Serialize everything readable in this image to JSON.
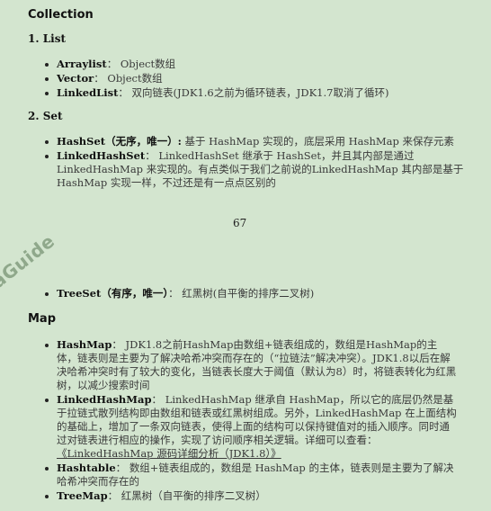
{
  "collection": {
    "title": "Collection",
    "list": {
      "heading": "1. List",
      "items": [
        {
          "term": "Arraylist",
          "sep": "： ",
          "desc": "Object数组"
        },
        {
          "term": "Vector",
          "sep": "： ",
          "desc": "Object数组"
        },
        {
          "term": "LinkedList",
          "sep": "： ",
          "desc": "双向链表(JDK1.6之前为循环链表，JDK1.7取消了循环)"
        }
      ]
    },
    "set": {
      "heading": "2. Set",
      "items": [
        {
          "term": "HashSet（无序，唯一）:",
          "sep": " ",
          "desc": "基于 HashMap 实现的，底层采用 HashMap 来保存元素"
        },
        {
          "term": "LinkedHashSet",
          "sep": "： ",
          "desc": "LinkedHashSet 继承于 HashSet，并且其内部是通过 LinkedHashMap 来实现的。有点类似于我们之前说的LinkedHashMap 其内部是基于 HashMap 实现一样，不过还是有一点点区别的"
        },
        {
          "term": "TreeSet（有序，唯一）",
          "sep": "： ",
          "desc": "红黑树(自平衡的排序二叉树)"
        }
      ]
    }
  },
  "page_number": "67",
  "watermark": "aGuide",
  "map": {
    "title": "Map",
    "items": [
      {
        "term": "HashMap",
        "sep": "： ",
        "desc": "JDK1.8之前HashMap由数组+链表组成的，数组是HashMap的主体，链表则是主要为了解决哈希冲突而存在的（“拉链法”解决冲突）。JDK1.8以后在解决哈希冲突时有了较大的变化，当链表长度大于阈值（默认为8）时，将链表转化为红黑树，以减少搜索时间"
      },
      {
        "term": "LinkedHashMap",
        "sep": "： ",
        "desc": "LinkedHashMap 继承自 HashMap，所以它的底层仍然是基于拉链式散列结构即由数组和链表或红黑树组成。另外，LinkedHashMap 在上面结构的基础上，增加了一条双向链表，使得上面的结构可以保持键值对的插入顺序。同时通过对链表进行相应的操作，实现了访问顺序相关逻辑。详细可以查看：",
        "link": "《LinkedHashMap 源码详细分析（JDK1.8）》"
      },
      {
        "term": "Hashtable",
        "sep": "： ",
        "desc": "数组+链表组成的，数组是 HashMap 的主体，链表则是主要为了解决哈希冲突而存在的"
      },
      {
        "term": "TreeMap",
        "sep": "： ",
        "desc": "红黑树（自平衡的排序二叉树）"
      }
    ]
  }
}
